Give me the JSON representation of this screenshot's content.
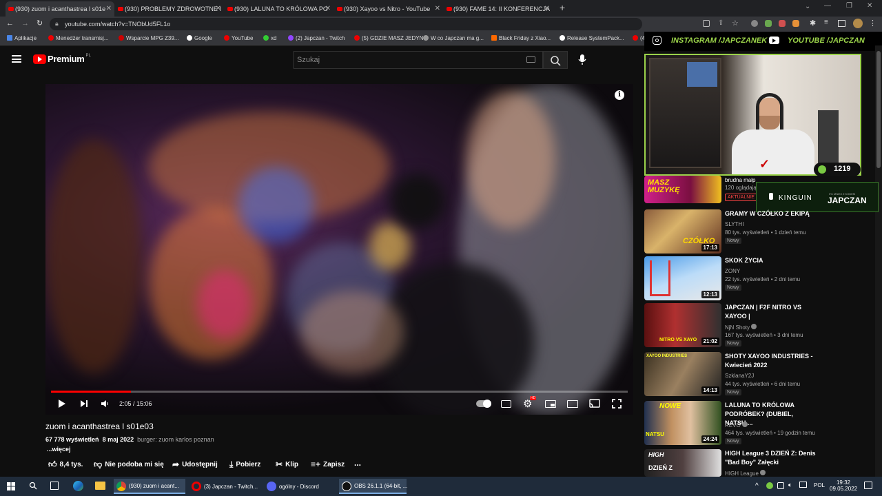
{
  "browser": {
    "tabs": [
      {
        "label": "(930) zuom i acanthastrea l s01e"
      },
      {
        "label": "(930) PROBLEMY ZDROWOTNE I"
      },
      {
        "label": "(930) LALUNA TO KRÓLOWA PO"
      },
      {
        "label": "(930) Xayoo vs Nitro - YouTube"
      },
      {
        "label": "(930) FAME 14: II KONFERENCJA"
      }
    ],
    "url": "youtube.com/watch?v=TNObUd5FL1o",
    "bookmarks": [
      "Aplikacje",
      "Menedżer transmisj...",
      "Wsparcie MPG Z39...",
      "Google",
      "YouTube",
      "xd",
      "(2) Japczan - Twitch",
      "(5) GDZIE MASZ JEDYN...",
      "W co Japczan ma g...",
      "Black Friday z Xiao...",
      "Release SystemPack...",
      "(4"
    ]
  },
  "header": {
    "logo": "Premium",
    "region": "PL",
    "search_placeholder": "Szukaj"
  },
  "player": {
    "time": "2:05 / 15:06",
    "progress": 0.138
  },
  "video": {
    "title": "zuom i acanthastrea l s01e03",
    "views": "67 778 wyświetleń",
    "date": "8 maj 2022",
    "hashtags": "burger: zuom karlos poznan",
    "more": "...więcej",
    "actions": {
      "likes": "8,4 tys.",
      "dislike": "Nie podoba mi się",
      "share": "Udostępnij",
      "download": "Pobierz",
      "clip": "Klip",
      "save": "Zapisz",
      "more": "..."
    }
  },
  "stream_overlay": {
    "instagram": "INSTAGRAM /JAPCZANEK",
    "youtube": "YOUTUBE /JAPCZAN",
    "counter": "1219",
    "sponsor": "KINGUIN",
    "sponsor_note": "5% MNIEJ Z KODEM",
    "sponsor_code": "JAPCZAN"
  },
  "recommendations": [
    {
      "title": "brudna małp",
      "meta": "120 oglądają",
      "badge": "AKTUALNIE"
    },
    {
      "title": "GRAMY W CZÓŁKO Z EKIPĄ",
      "channel": "SLYTHI",
      "meta": "80 tys. wyświetleń • 1 dzień temu",
      "badge": "Nowy",
      "duration": "17:13"
    },
    {
      "title": "SKOK ŻYCIA",
      "channel": "ZONY",
      "meta": "22 tys. wyświetleń • 2 dni temu",
      "badge": "Nowy",
      "duration": "12:13"
    },
    {
      "title": "JAPCZAN | F2F NITRO VS XAYOO |",
      "channel": "NjN Shoty",
      "meta": "167 tys. wyświetleń • 3 dni temu",
      "badge": "Nowy",
      "duration": "21:02"
    },
    {
      "title": "SHOTY XAYOO INDUSTRIES - Kwiecień 2022",
      "channel": "SzklanaY2J",
      "meta": "44 tys. wyświetleń • 6 dni temu",
      "badge": "Nowy",
      "duration": "14:13"
    },
    {
      "title": "LALUNA TO KRÓLOWA PODRÓBEK? (DUBIEL, NATSU,...",
      "channel": "REVO",
      "meta": "464 tys. wyświetleń • 19 godzin temu",
      "badge": "Nowy",
      "duration": "24:24"
    },
    {
      "title": "HIGH League 3 DZIEŃ Z: Denis \"Bad Boy\" Załęcki",
      "channel": "HIGH League",
      "meta": "",
      "badge": "",
      "duration": ""
    }
  ],
  "taskbar": {
    "tasks": [
      "(930) zuom i acant...",
      "(3) Japczan - Twitch...",
      "ogólny - Discord",
      "OBS 26.1.1 (64-bit, ..."
    ],
    "lang": "POL",
    "time": "19:32",
    "date": "09.05.2022"
  }
}
